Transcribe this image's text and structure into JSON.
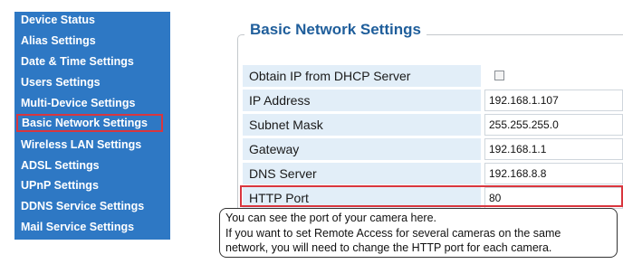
{
  "sidebar": {
    "items": [
      {
        "label": "Device Status"
      },
      {
        "label": "Alias Settings"
      },
      {
        "label": "Date & Time Settings"
      },
      {
        "label": "Users Settings"
      },
      {
        "label": "Multi-Device Settings"
      },
      {
        "label": "Basic Network Settings"
      },
      {
        "label": "Wireless LAN Settings"
      },
      {
        "label": "ADSL Settings"
      },
      {
        "label": "UPnP Settings"
      },
      {
        "label": "DDNS Service Settings"
      },
      {
        "label": "Mail Service Settings"
      }
    ],
    "active_item": "Basic Network Settings",
    "color": "#2e78c4",
    "highlight_color": "#d9363e"
  },
  "main": {
    "title": "Basic Network Settings",
    "title_color": "#1f5e9b",
    "rows": [
      {
        "label": "Obtain IP from DHCP Server",
        "type": "checkbox",
        "checked": false
      },
      {
        "label": "IP Address",
        "value": "192.168.1.107"
      },
      {
        "label": "Subnet Mask",
        "value": "255.255.255.0"
      },
      {
        "label": "Gateway",
        "value": "192.168.1.1"
      },
      {
        "label": "DNS Server",
        "value": "192.168.8.8"
      },
      {
        "label": "HTTP Port",
        "value": "80"
      }
    ],
    "highlighted_row": "HTTP Port"
  },
  "callout": {
    "lines": [
      "You can see the port of your camera here.",
      "If you want to set Remote Access for several cameras on the same",
      "network, you will need to change the HTTP port for each camera."
    ]
  }
}
